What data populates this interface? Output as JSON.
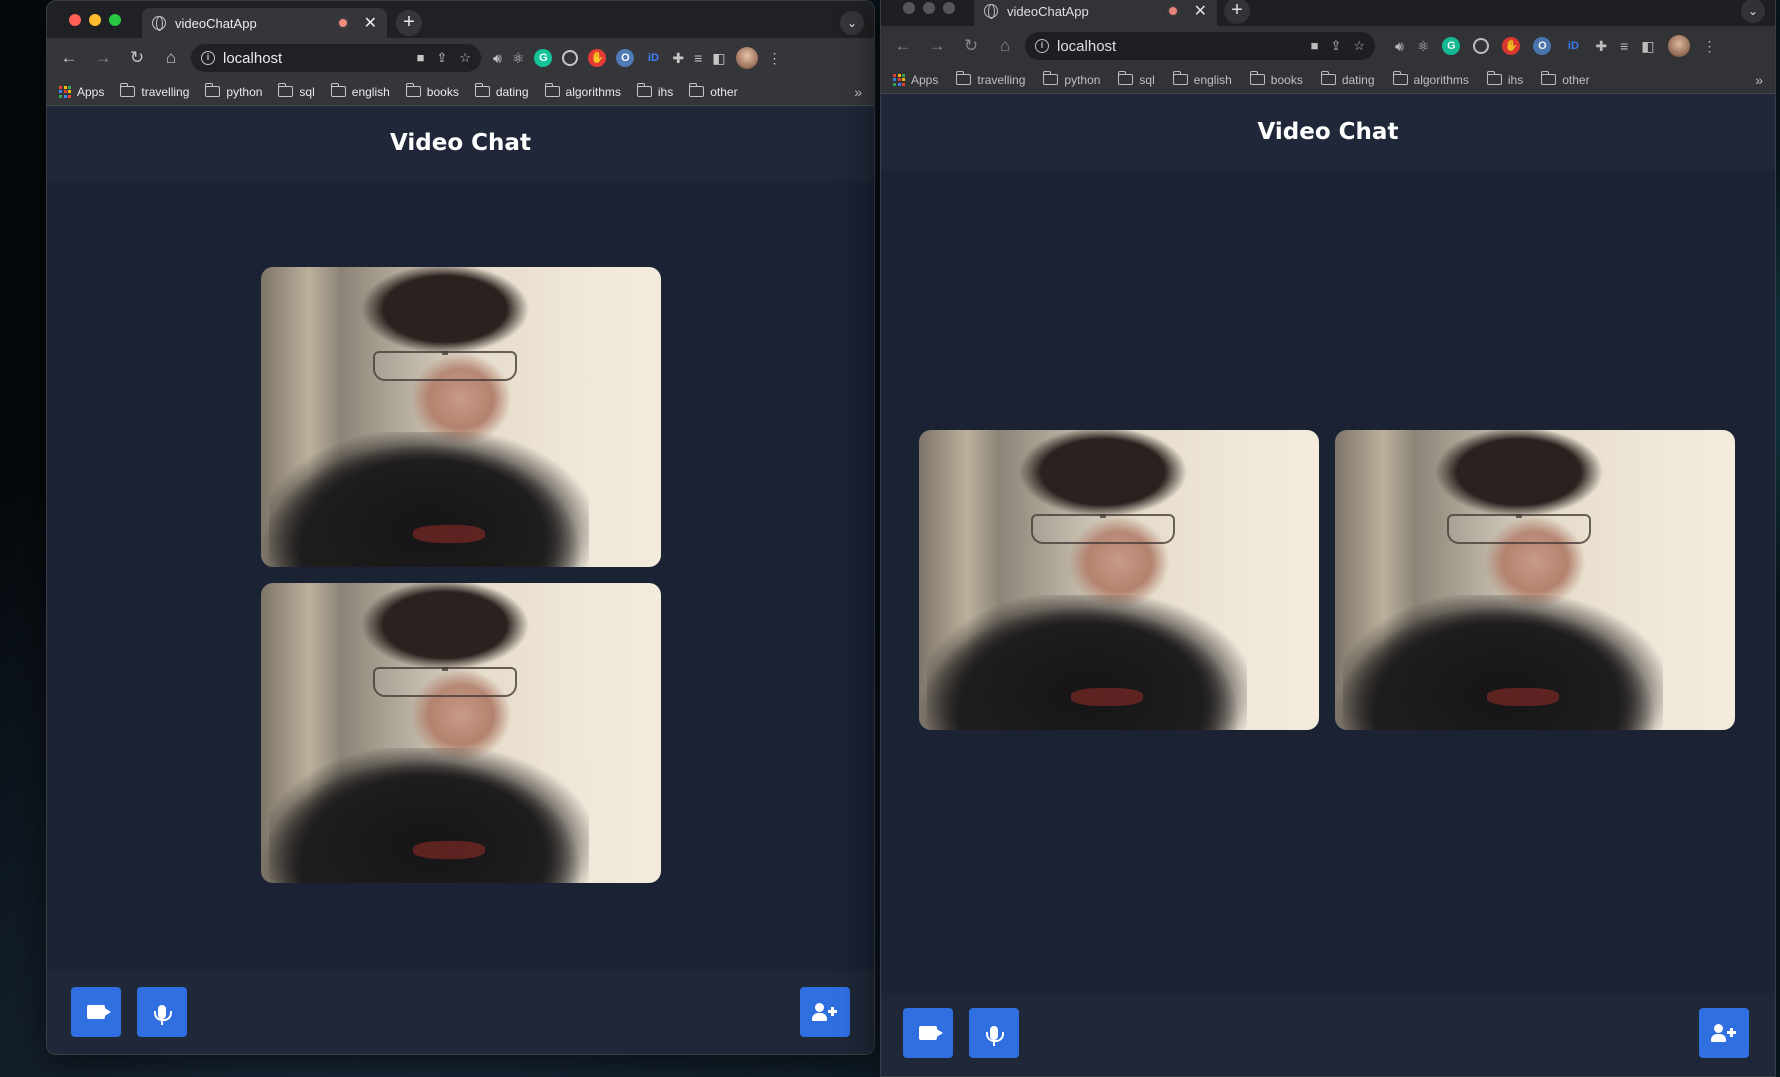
{
  "browser": {
    "tab_title": "videoChatApp",
    "url": "localhost",
    "bookmarks": [
      "Apps",
      "travelling",
      "python",
      "sql",
      "english",
      "books",
      "dating",
      "algorithms",
      "ihs",
      "other"
    ],
    "bookmarks_more": "»"
  },
  "app": {
    "title": "Video Chat",
    "controls": {
      "camera": "video-camera-icon",
      "microphone": "microphone-icon",
      "invite": "add-user-icon"
    },
    "accent_color": "#2f6fe0",
    "background_color": "#1a2233"
  },
  "windows": [
    {
      "name": "left",
      "layout": "stacked",
      "video_count": 2
    },
    {
      "name": "right",
      "layout": "side-by-side",
      "video_count": 2
    }
  ]
}
